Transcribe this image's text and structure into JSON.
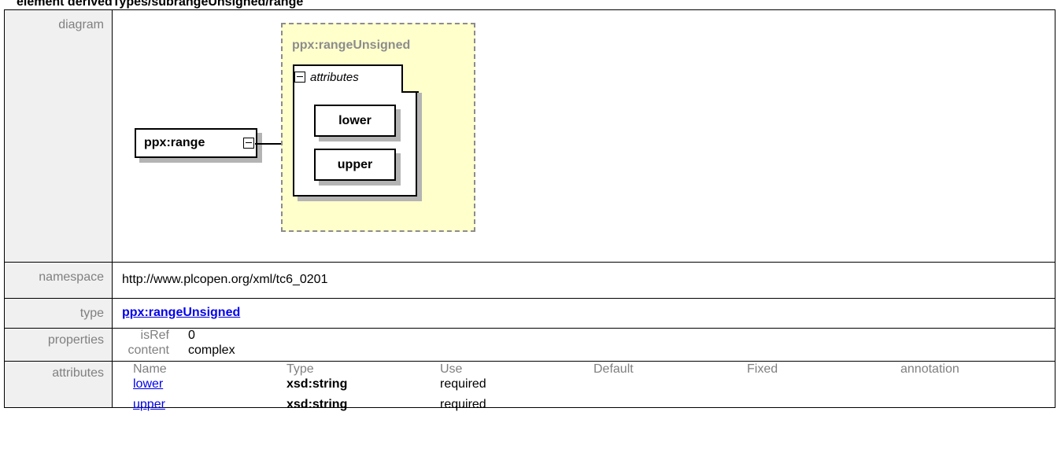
{
  "heading": "element derivedTypes/subrangeUnsigned/range",
  "rows": {
    "diagram_label": "diagram",
    "namespace_label": "namespace",
    "namespace_value": "http://www.plcopen.org/xml/tc6_0201",
    "type_label": "type",
    "type_value": "ppx:rangeUnsigned",
    "properties_label": "properties",
    "attributes_label": "attributes"
  },
  "properties": [
    {
      "key": "isRef",
      "value": "0"
    },
    {
      "key": "content",
      "value": "complex"
    }
  ],
  "attributes_table": {
    "headers": [
      "Name",
      "Type",
      "Use",
      "Default",
      "Fixed",
      "annotation"
    ],
    "rows": [
      {
        "name": "lower",
        "type": "xsd:string",
        "use": "required"
      },
      {
        "name": "upper",
        "type": "xsd:string",
        "use": "required"
      }
    ]
  },
  "diagram": {
    "element_name": "ppx:range",
    "group_title": "ppx:rangeUnsigned",
    "attributes_group_label": "attributes",
    "attribute_nodes": [
      "lower",
      "upper"
    ],
    "colors": {
      "group_fill": "#ffffcc",
      "group_border": "#8c8c8c",
      "shadow": "#b4b4b4"
    }
  }
}
